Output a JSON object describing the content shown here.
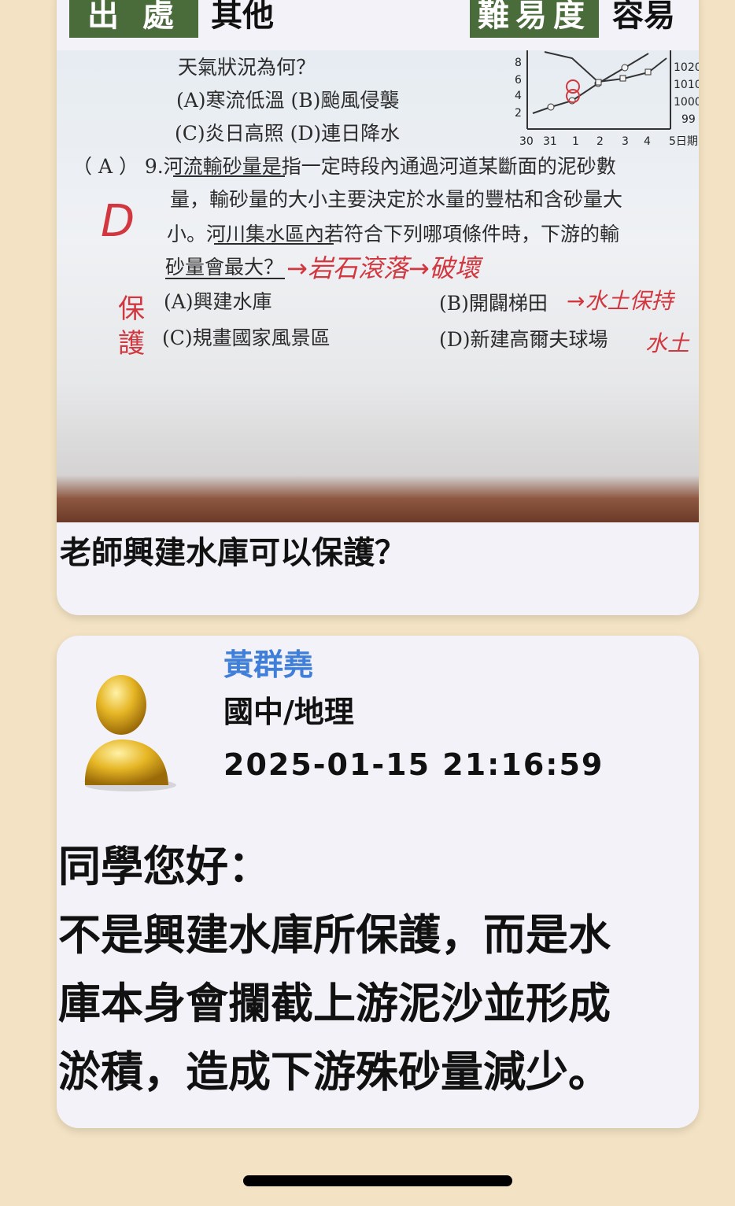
{
  "meta": {
    "source_label": "出 處",
    "source_value": "其他",
    "difficulty_label": "難易度",
    "difficulty_value": "容易"
  },
  "photo": {
    "exam_lines": [
      "天氣狀況為何？",
      "(A)寒流低溫 (B)颱風侵襲",
      "(C)炎日高照 (D)連日降水",
      "（ A ） 9.河流輸砂量是指一定時段內通過河道某斷面的泥砂數",
      "量，輸砂量的大小主要決定於水量的豐枯和含砂量大",
      "小。河川集水區內若符合下列哪項條件時，下游的輸",
      "砂量會最大？",
      "(A)興建水庫",
      "(B)開闢梯田",
      "(C)規畫國家風景區",
      "(D)新建高爾夫球場"
    ],
    "handwritten_notes": [
      "D",
      "→岩石滾落→破壞",
      "→水土保持",
      "保護",
      "水土"
    ],
    "chart_ticks": {
      "left": [
        "8",
        "6",
        "4",
        "2"
      ],
      "bottom": [
        "30",
        "31",
        "1",
        "2",
        "3",
        "4",
        "5日期"
      ],
      "right": [
        "1020",
        "1010",
        "1000",
        "99"
      ]
    }
  },
  "question": {
    "text": "老師興建水庫可以保護？"
  },
  "answer": {
    "name": "黃群堯",
    "subject": "國中/地理",
    "timestamp": "2025-01-15 21:16:59",
    "body_lines": [
      "同學您好：",
      "不是興建水庫所保護，而是水",
      "庫本身會攔截上游泥沙並形成",
      "淤積，造成下游殊砂量減少。"
    ]
  }
}
